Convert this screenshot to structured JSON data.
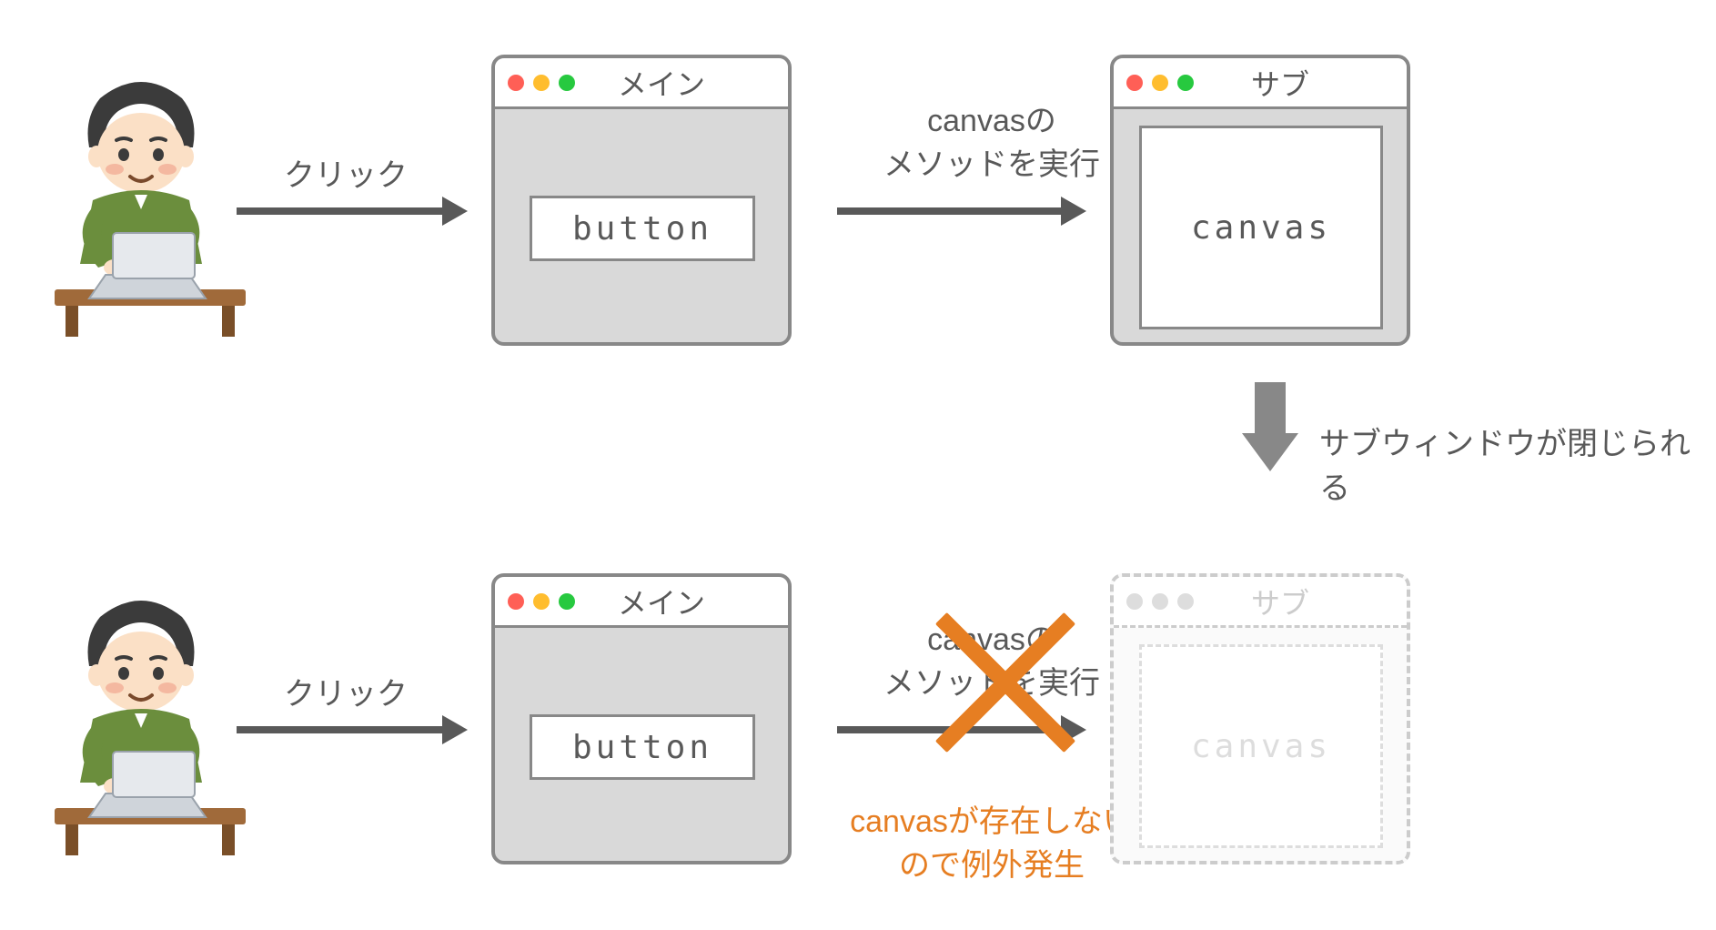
{
  "scene1": {
    "click_label": "クリック",
    "exec_label_line1": "canvasの",
    "exec_label_line2": "メソッドを実行",
    "main_window": {
      "title": "メイン",
      "button_label": "button"
    },
    "sub_window": {
      "title": "サブ",
      "canvas_label": "canvas"
    }
  },
  "transition_label": "サブウィンドウが閉じられる",
  "scene2": {
    "click_label": "クリック",
    "exec_label_line1": "canvasの",
    "exec_label_line2": "メソッドを実行",
    "error_label_line1": "canvasが存在しない",
    "error_label_line2": "ので例外発生",
    "main_window": {
      "title": "メイン",
      "button_label": "button"
    },
    "sub_window": {
      "title": "サブ",
      "canvas_label": "canvas"
    }
  },
  "colors": {
    "gray": "#595959",
    "orange": "#e67e22",
    "traffic_red": "#ff5f56",
    "traffic_yellow": "#ffbd2e",
    "traffic_green": "#27c93f"
  }
}
